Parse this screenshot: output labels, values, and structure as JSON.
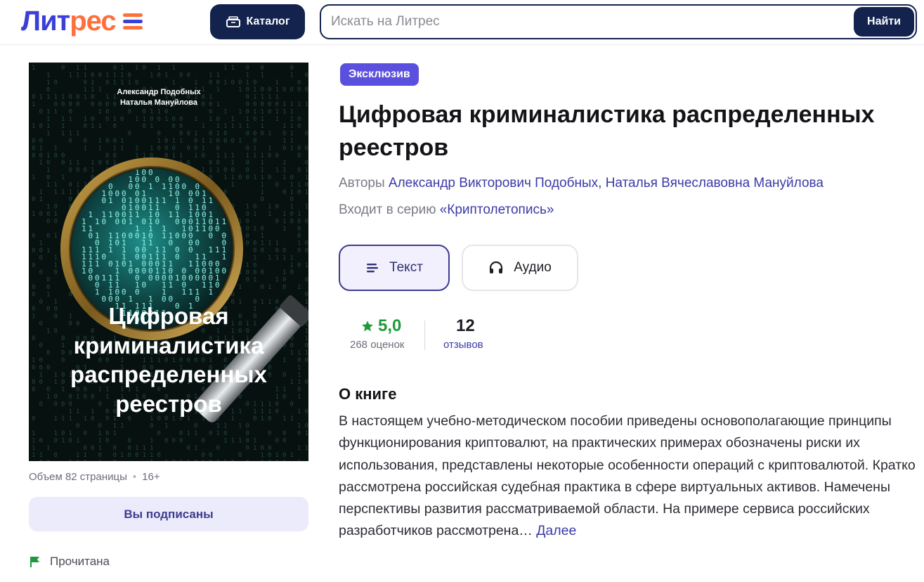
{
  "header": {
    "logo_part1": "Лит",
    "logo_part2": "рес",
    "logo_icon": "menu-bars-icon",
    "catalog_label": "Каталог",
    "search_placeholder": "Искать на Литрес",
    "search_button": "Найти"
  },
  "colors": {
    "brand_dark": "#13234e",
    "brand_blue": "#3b3fd8",
    "brand_orange": "#ff6f3c",
    "badge": "#5b4fdd",
    "link": "#3a3aa8",
    "rating_green": "#1f9a3b"
  },
  "cover": {
    "author1": "Александр Подобных",
    "author2": "Наталья Мануйлова",
    "title_lines": [
      "Цифровая",
      "криминалистика",
      "распределенных",
      "реестров"
    ]
  },
  "book": {
    "badge": "Эксклюзив",
    "title": "Цифровая криминалистика распределенных реестров",
    "authors_label": "Авторы",
    "authors": "Александр Викторович Подобных, Наталья Вячеславовна Мануйлова",
    "series_label": "Входит в серию",
    "series": "«Криптолетопись»",
    "volume": "Объем 82 страницы",
    "age": "16+",
    "subscribe_label": "Вы подписаны",
    "read_status": "Прочитана"
  },
  "formats": {
    "text_label": "Текст",
    "text_icon": "lines-icon",
    "audio_label": "Аудио",
    "audio_icon": "headphones-icon"
  },
  "rating": {
    "value": "5,0",
    "count_label": "268 оценок",
    "reviews_value": "12",
    "reviews_label": "отзывов"
  },
  "about": {
    "title": "О книге",
    "text": "В настоящем учебно-методическом пособии приведены основополагающие принципы функционирования криптовалют, на практических примерах обозначены риски их использования, представлены некоторые особенности операций с криптовалютой. Кратко рассмотрена российская судебная практика в сфере виртуальных активов. Намечены перспективы развития рассматриваемой области. На примере сервиса российских разработчиков рассмотрена…",
    "more_label": "Далее"
  }
}
